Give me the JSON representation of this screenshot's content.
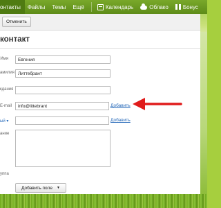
{
  "nav": {
    "items": [
      {
        "label": "онтакты",
        "active": true
      },
      {
        "label": "Файлы"
      },
      {
        "label": "Темы"
      },
      {
        "label": "Ещё"
      }
    ],
    "services": [
      {
        "label": "Календарь",
        "icon": "calendar-icon"
      },
      {
        "label": "Облако",
        "icon": "cloud-icon"
      },
      {
        "label": "Бонус",
        "icon": "gift-icon"
      }
    ]
  },
  "toolbar": {
    "cancel_label": "Отменить"
  },
  "page": {
    "title": "контакт"
  },
  "form": {
    "first_name": {
      "label": "Имя",
      "value": "Евгения"
    },
    "last_name": {
      "label": "амилия",
      "value": "Литтебрант"
    },
    "nickname": {
      "label": "кдания",
      "value": ""
    },
    "email": {
      "label": "E-mail",
      "value": "info@littebrant",
      "add_label": "Добавить"
    },
    "phone": {
      "label": "ый ▾",
      "value": "",
      "add_label": "Добавить"
    },
    "comment": {
      "label": "ание",
      "value": ""
    },
    "group": {
      "label": "уппа",
      "value": ""
    },
    "add_field_label": "Добавить поле"
  },
  "colors": {
    "nav_bg": "#5e8c19",
    "link": "#2a6cbb",
    "arrow": "#e01b1b"
  }
}
